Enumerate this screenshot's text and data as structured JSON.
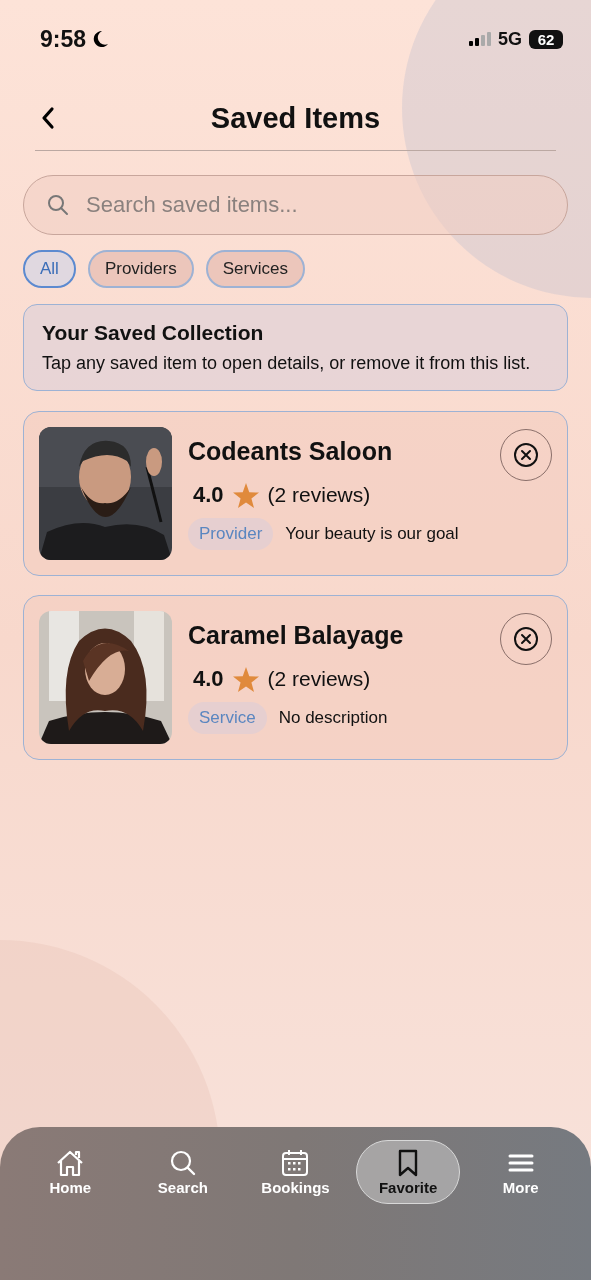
{
  "status_bar": {
    "time": "9:58",
    "network": "5G",
    "battery": "62"
  },
  "header": {
    "title": "Saved Items"
  },
  "search": {
    "placeholder": "Search saved items..."
  },
  "filters": [
    {
      "label": "All",
      "selected": true
    },
    {
      "label": "Providers",
      "selected": false
    },
    {
      "label": "Services",
      "selected": false
    }
  ],
  "intro": {
    "title": "Your Saved Collection",
    "text": "Tap any saved item to open details, or remove it from this list."
  },
  "items": [
    {
      "name": "Codeants Saloon",
      "rating": "4.0",
      "reviews": "(2 reviews)",
      "type": "Provider",
      "description": "Your beauty is our goal",
      "kind": "provider"
    },
    {
      "name": "Caramel Balayage",
      "rating": "4.0",
      "reviews": "(2 reviews)",
      "type": "Service",
      "description": "No description",
      "kind": "service"
    }
  ],
  "tab_bar": [
    {
      "label": "Home",
      "selected": false
    },
    {
      "label": "Search",
      "selected": false
    },
    {
      "label": "Bookings",
      "selected": false
    },
    {
      "label": "Favorite",
      "selected": true
    },
    {
      "label": "More",
      "selected": false
    }
  ]
}
